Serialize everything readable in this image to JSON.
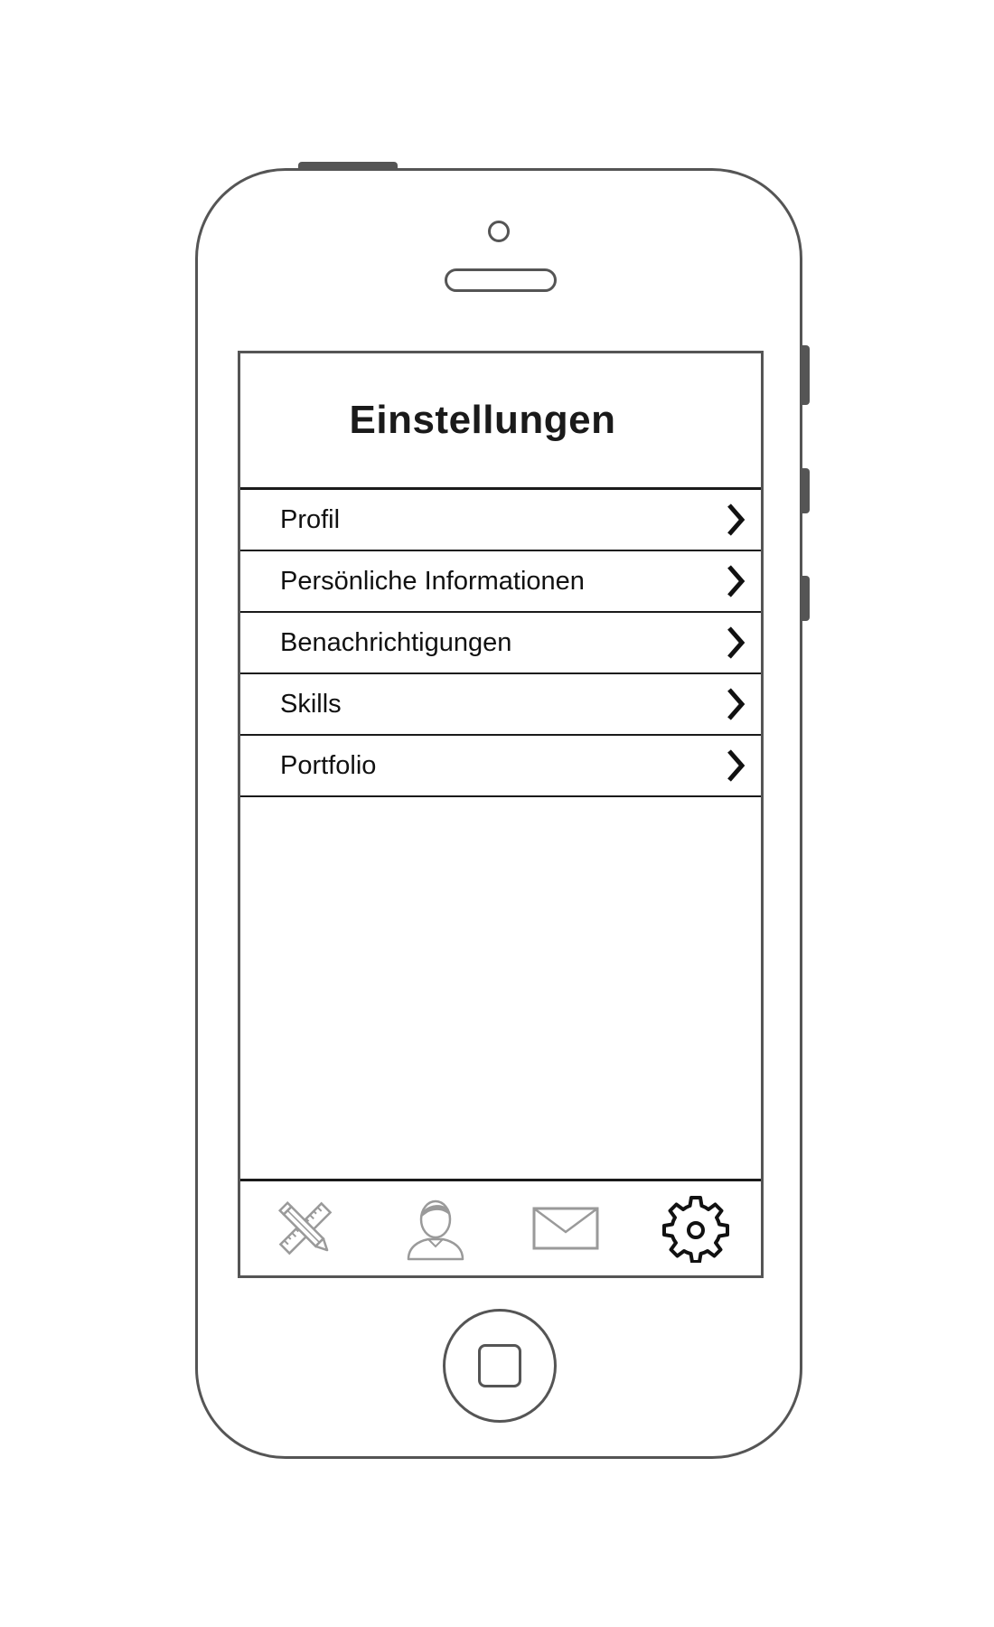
{
  "screen": {
    "title": "Einstellungen"
  },
  "menu": {
    "items": [
      {
        "label": "Profil"
      },
      {
        "label": "Persönliche Informationen"
      },
      {
        "label": "Benachrichtigungen"
      },
      {
        "label": "Skills"
      },
      {
        "label": "Portfolio"
      }
    ]
  },
  "tabbar": {
    "tabs": [
      {
        "icon": "pencil-ruler-icon",
        "active": false
      },
      {
        "icon": "user-icon",
        "active": false
      },
      {
        "icon": "mail-icon",
        "active": false
      },
      {
        "icon": "gear-icon",
        "active": true
      }
    ]
  },
  "colors": {
    "frame": "#555555",
    "text": "#111111",
    "inactive_icon": "#9a9a9a",
    "active_icon": "#111111"
  }
}
